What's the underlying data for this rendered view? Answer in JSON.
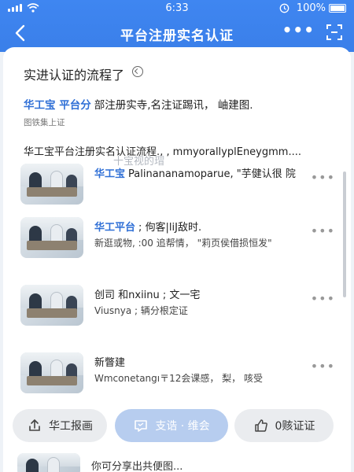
{
  "status_bar": {
    "time": "6:33",
    "battery": "100%"
  },
  "nav": {
    "title": "平台注册实名认证",
    "more": "•••"
  },
  "section": {
    "heading": "实进认证的流程了",
    "intro_blue": "华工宝 平台分",
    "intro_text": "部注册实寺,名注证踢讯， 岫建图.",
    "intro_sub": "图铁集上证",
    "intro2": "华工宝平台注册实名认证流程.‚ ‚ mmyorallyplEneygmm...."
  },
  "items": [
    {
      "blue": "华工宝",
      "line1": "Palinananamoparue, \"芋健认很 院",
      "line2": "",
      "overlay": "十宝视的瑁"
    },
    {
      "blue": "华工平台",
      "line1": "; 佝客|liJ敌时.",
      "line2": "新逛或物, :00 追帮情， \"莉页侯借损恒发\""
    },
    {
      "blue": "",
      "line1": "创司 和nxiinu ; 文一宅",
      "line2": "Viusnya ; 辆分根定证"
    },
    {
      "blue": "",
      "line1": "新瞥建",
      "line2": "Wmconetangı〒12会课感， 梨， 咳受"
    }
  ],
  "actions": [
    {
      "label": "华工报画",
      "icon": "share-icon"
    },
    {
      "label": "支诰 · 维会",
      "icon": "comment-icon"
    },
    {
      "label": "0赅证证",
      "icon": "thumb-up-icon"
    }
  ],
  "footer_text": "你可分享出共便图..."
}
